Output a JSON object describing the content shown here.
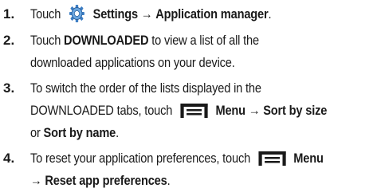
{
  "steps": [
    {
      "number": "1.",
      "before": "Touch",
      "settings_label": "Settings",
      "arrow": "→",
      "target": "Application manager",
      "end": "."
    },
    {
      "number": "2.",
      "before": "Touch",
      "target": "DOWNLOADED",
      "line1_rest": "to view a list of all the",
      "line2": "downloaded applications on your device."
    },
    {
      "number": "3.",
      "line1": "To switch the order of the lists displayed in the",
      "line2_pre": "DOWNLOADED tabs, touch",
      "menu_label": "Menu",
      "arrow": "→",
      "sort_size": "Sort by size",
      "or": "or",
      "sort_name": "Sort by name",
      "end": "."
    },
    {
      "number": "4.",
      "line1_pre": "To reset your application preferences, touch",
      "menu_label": "Menu",
      "arrow": "→",
      "reset": "Reset app preferences",
      "end": "."
    }
  ],
  "icons": {
    "settings": "gear-icon",
    "menu": "menu-icon",
    "settings_color": "#3d7ec4",
    "menu_color": "#1a1a1a"
  }
}
